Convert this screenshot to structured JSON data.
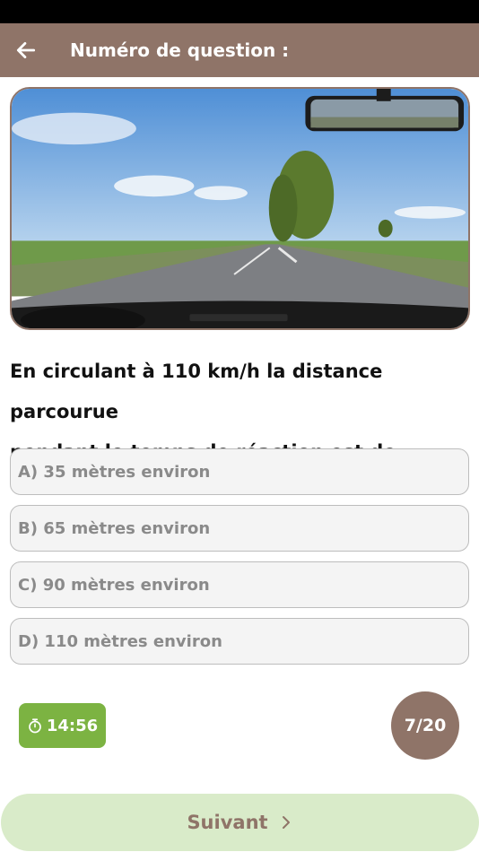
{
  "header": {
    "title": "Numéro de question :",
    "back_icon": "arrow-left-icon"
  },
  "question": {
    "image": "dashcam-road-photo",
    "text_line1": "En circulant à 110 km/h la distance parcourue",
    "text_line2": "pendant le temps de réaction est de"
  },
  "answers": [
    {
      "label": "A) 35 mètres environ"
    },
    {
      "label": "B) 65 mètres environ"
    },
    {
      "label": "C) 90 mètres environ"
    },
    {
      "label": "D) 110 mètres environ"
    }
  ],
  "timer": {
    "icon": "stopwatch-icon",
    "value": "14:56"
  },
  "progress": {
    "label": "7/20",
    "current": 7,
    "total": 20
  },
  "footer": {
    "next_label": "Suivant",
    "next_icon": "chevron-right-icon"
  },
  "colors": {
    "primary": "#8f7468",
    "timer_green": "#7cb342",
    "next_bg": "#d9ebc9"
  }
}
